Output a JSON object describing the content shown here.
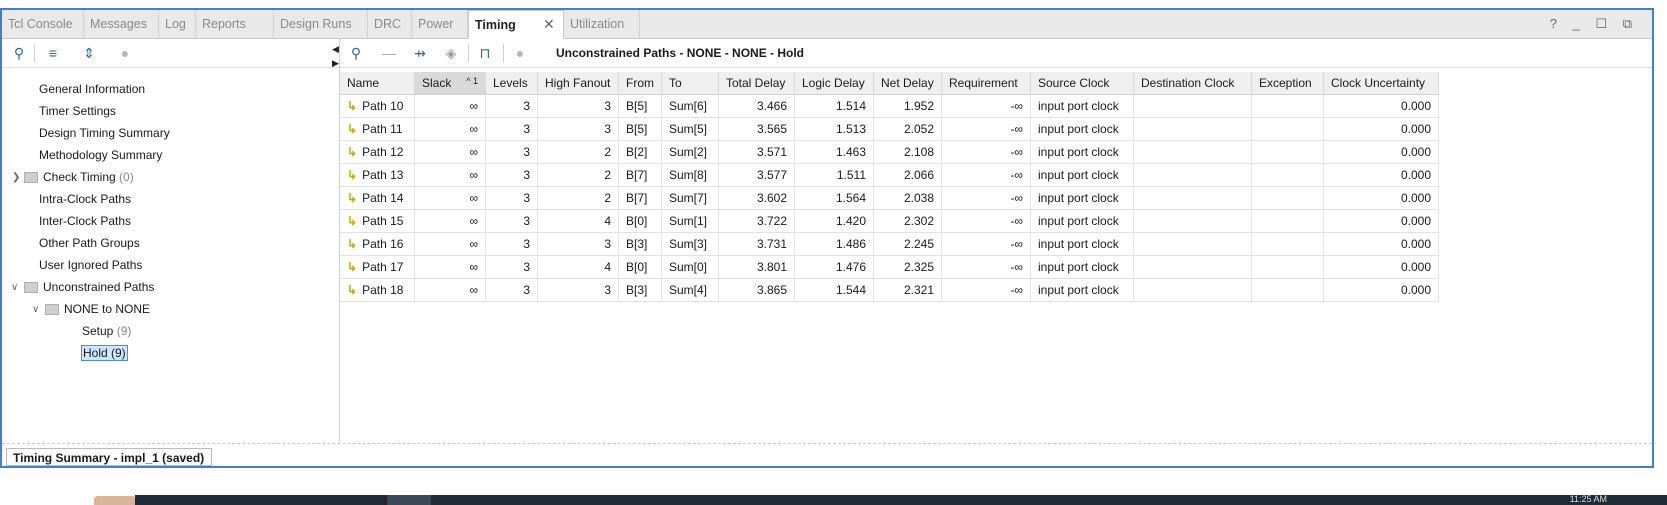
{
  "tabs": [
    "Tcl Console",
    "Messages",
    "Log",
    "Reports",
    "Design Runs",
    "DRC",
    "Power",
    "Timing",
    "Utilization"
  ],
  "active_tab": "Timing",
  "window_controls": "? _ ☐ ⧉",
  "left_tree": {
    "items": [
      {
        "label": "General Information"
      },
      {
        "label": "Timer Settings"
      },
      {
        "label": "Design Timing Summary"
      },
      {
        "label": "Methodology Summary"
      },
      {
        "label": "Check Timing",
        "count": "(0)"
      },
      {
        "label": "Intra-Clock Paths"
      },
      {
        "label": "Inter-Clock Paths"
      },
      {
        "label": "Other Path Groups"
      },
      {
        "label": "User Ignored Paths"
      },
      {
        "label": "Unconstrained Paths"
      },
      {
        "label": "NONE to NONE"
      },
      {
        "label": "Setup",
        "count": "(9)"
      },
      {
        "label": "Hold (9)"
      }
    ]
  },
  "panel_title": "Unconstrained Paths - NONE - NONE - Hold",
  "table": {
    "columns": [
      "Name",
      "Slack",
      "Levels",
      "High Fanout",
      "From",
      "To",
      "Total Delay",
      "Logic Delay",
      "Net Delay",
      "Requirement",
      "Source Clock",
      "Destination Clock",
      "Exception",
      "Clock Uncertainty"
    ],
    "sort_indicator": "^ 1",
    "rows": [
      [
        "Path 10",
        "∞",
        "3",
        "3",
        "B[5]",
        "Sum[6]",
        "3.466",
        "1.514",
        "1.952",
        "-∞",
        "input port clock",
        "",
        "",
        "0.000"
      ],
      [
        "Path 11",
        "∞",
        "3",
        "3",
        "B[5]",
        "Sum[5]",
        "3.565",
        "1.513",
        "2.052",
        "-∞",
        "input port clock",
        "",
        "",
        "0.000"
      ],
      [
        "Path 12",
        "∞",
        "3",
        "2",
        "B[2]",
        "Sum[2]",
        "3.571",
        "1.463",
        "2.108",
        "-∞",
        "input port clock",
        "",
        "",
        "0.000"
      ],
      [
        "Path 13",
        "∞",
        "3",
        "2",
        "B[7]",
        "Sum[8]",
        "3.577",
        "1.511",
        "2.066",
        "-∞",
        "input port clock",
        "",
        "",
        "0.000"
      ],
      [
        "Path 14",
        "∞",
        "3",
        "2",
        "B[7]",
        "Sum[7]",
        "3.602",
        "1.564",
        "2.038",
        "-∞",
        "input port clock",
        "",
        "",
        "0.000"
      ],
      [
        "Path 15",
        "∞",
        "3",
        "4",
        "B[0]",
        "Sum[1]",
        "3.722",
        "1.420",
        "2.302",
        "-∞",
        "input port clock",
        "",
        "",
        "0.000"
      ],
      [
        "Path 16",
        "∞",
        "3",
        "3",
        "B[3]",
        "Sum[3]",
        "3.731",
        "1.486",
        "2.245",
        "-∞",
        "input port clock",
        "",
        "",
        "0.000"
      ],
      [
        "Path 17",
        "∞",
        "3",
        "4",
        "B[0]",
        "Sum[0]",
        "3.801",
        "1.476",
        "2.325",
        "-∞",
        "input port clock",
        "",
        "",
        "0.000"
      ],
      [
        "Path 18",
        "∞",
        "3",
        "3",
        "B[3]",
        "Sum[4]",
        "3.865",
        "1.544",
        "2.321",
        "-∞",
        "input port clock",
        "",
        "",
        "0.000"
      ]
    ]
  },
  "bottom_button": "Timing Summary - impl_1 (saved)",
  "taskbar_clock": "11:25 AM"
}
